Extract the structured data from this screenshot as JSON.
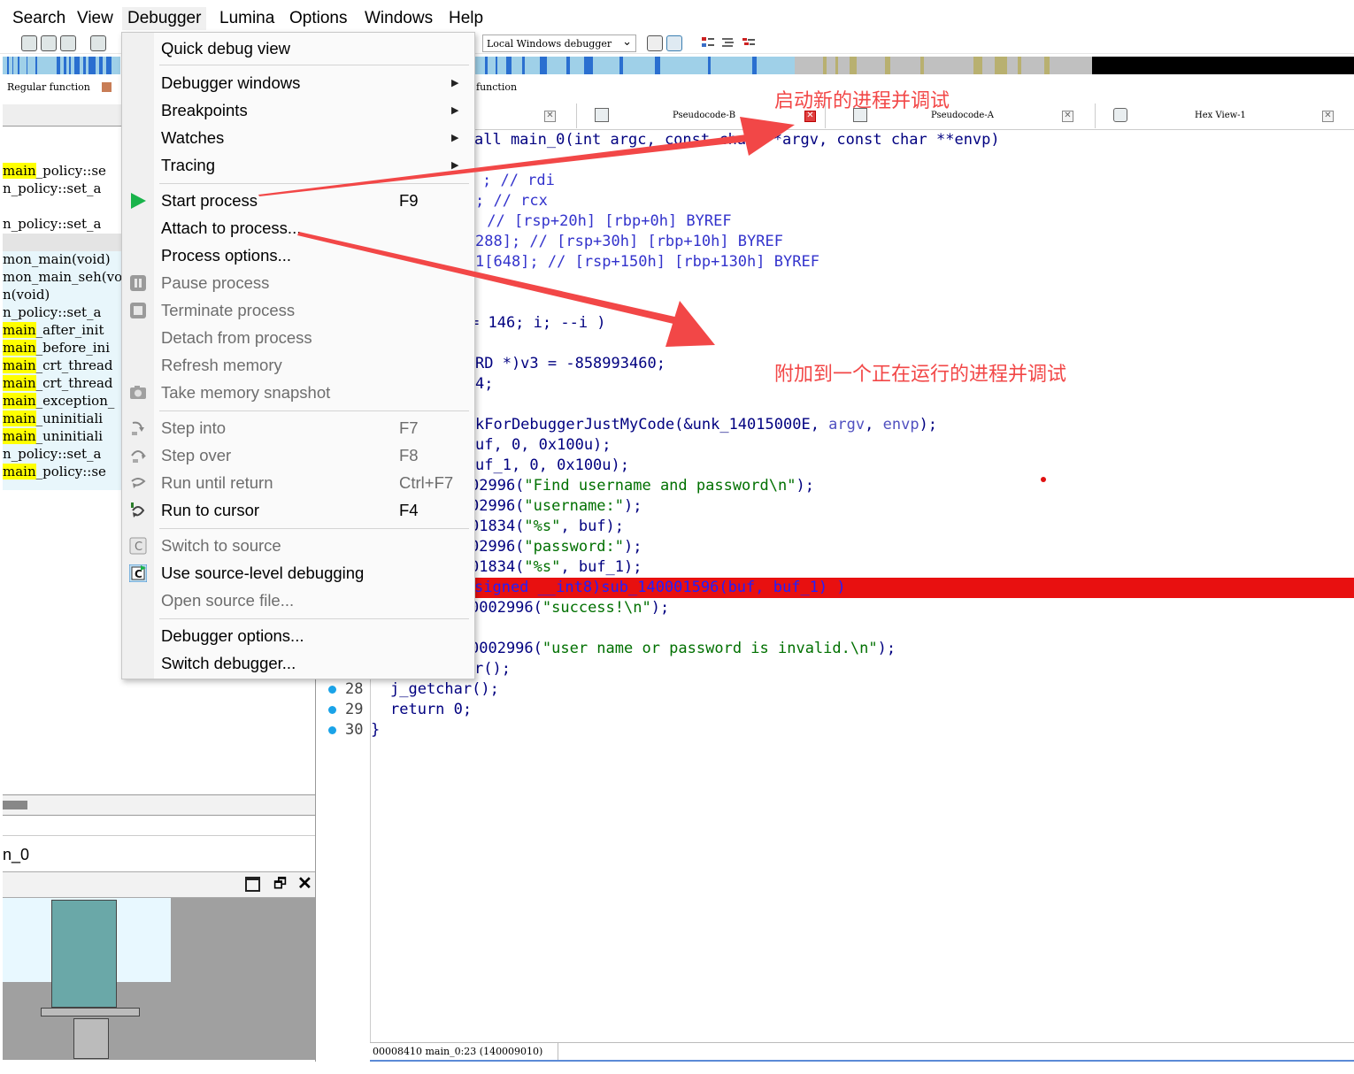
{
  "menubar": {
    "items": [
      "Search",
      "View",
      "Debugger",
      "Lumina",
      "Options",
      "Windows",
      "Help"
    ]
  },
  "toolbar": {
    "debugger_select": "Local Windows debugger"
  },
  "legend": {
    "regular_function": "Regular function",
    "function": "function"
  },
  "left_panel": {
    "lines": [
      {
        "hl": "main",
        "rest": "_policy::se"
      },
      {
        "hl": "",
        "rest": "n_policy::set_a"
      },
      {
        "hl": "",
        "rest": "n_policy::set_a"
      },
      {
        "hl": "",
        "rest": "mon_main(void)"
      },
      {
        "hl": "",
        "rest": "mon_main_seh(vo"
      },
      {
        "hl": "",
        "rest": "n(void)"
      },
      {
        "hl": "",
        "rest": "n_policy::set_a"
      },
      {
        "hl": "main",
        "rest": "_after_init"
      },
      {
        "hl": "main",
        "rest": "_before_ini"
      },
      {
        "hl": "main",
        "rest": "_crt_thread"
      },
      {
        "hl": "main",
        "rest": "_crt_thread"
      },
      {
        "hl": "main",
        "rest": "_exception_"
      },
      {
        "hl": "main",
        "rest": "_uninitiali"
      },
      {
        "hl": "main",
        "rest": "_uninitiali"
      },
      {
        "hl": "",
        "rest": "n_policy::set_a"
      },
      {
        "hl": "main",
        "rest": "_policy::se"
      }
    ],
    "function_name": "n_0"
  },
  "tabs": [
    {
      "label": "Pseudocode-B"
    },
    {
      "label": "Pseudocode-A"
    },
    {
      "label": "Hex View-1"
    }
  ],
  "code": {
    "line_numbers": [
      "28",
      "29",
      "30"
    ],
    "l_sig_a": "all main_0(int ",
    "l_sig_b": "argc, const",
    "l_sig_c": " char **argv, const char **envp)",
    "l1": "; // rdi",
    "l2": "; // rcx",
    "l3": " // [rsp+20h] [rbp+0h] BYREF",
    "l4": "288]; // [rsp+30h] [rbp+10h] BYREF",
    "l5": "1[648]; // [rsp+150h] [rbp+130h] BYREF",
    "l6": "= 146; i; --i )",
    "l7": "RD *)v3 = -858993460;",
    "l8": "4;",
    "l9a": "kForDebuggerJustMyCode(&unk_14015000E, ",
    "l9b": "argv",
    "l9c": ", ",
    "l9d": "envp",
    "l9e": ");",
    "l10": "uf, 0, 0x100u);",
    "l11": "uf_1, 0, 0x100u);",
    "l12a": "02996(",
    "l12b": "\"Find username and password\\n\"",
    "l12c": ");",
    "l13a": "02996(",
    "l13b": "\"username:\"",
    "l13c": ");",
    "l14a": "01834(",
    "l14b": "\"%s\"",
    "l14c": ", buf);",
    "l15a": "02996(",
    "l15b": "\"password:\"",
    "l15c": ");",
    "l16a": "01834(",
    "l16b": "\"%s\"",
    "l16c": ", buf_1);",
    "l17": "signed __int8)sub_140001596(buf, buf_1) )",
    "l18a": "0002996(",
    "l18b": "\"success!\\n\"",
    "l18c": ");",
    "l19a": "0002996(",
    "l19b": "\"user name or password is invalid.\\n\"",
    "l19c": ");",
    "l20": "r();",
    "l28": "j_getchar();",
    "l29": "return 0;",
    "l30": "}"
  },
  "dropdown": {
    "quick": "Quick debug view",
    "debugger_windows": "Debugger windows",
    "breakpoints": "Breakpoints",
    "watches": "Watches",
    "tracing": "Tracing",
    "start_process": "Start process",
    "start_shortcut": "F9",
    "attach": "Attach to process...",
    "process_options": "Process options...",
    "pause": "Pause process",
    "terminate": "Terminate process",
    "detach": "Detach from process",
    "refresh": "Refresh memory",
    "snapshot": "Take memory snapshot",
    "step_into": "Step into",
    "step_into_sc": "F7",
    "step_over": "Step over",
    "step_over_sc": "F8",
    "run_until": "Run until return",
    "run_until_sc": "Ctrl+F7",
    "run_cursor": "Run to cursor",
    "run_cursor_sc": "F4",
    "switch_source": "Switch to source",
    "use_source": "Use source-level debugging",
    "open_source": "Open source file...",
    "debugger_options": "Debugger options...",
    "switch_debugger": "Switch debugger..."
  },
  "annotations": {
    "start_new": "启动新的进程并调试",
    "attach_running": "附加到一个正在运行的进程并调试"
  },
  "status": {
    "text": "00008410 main_0:23 (140009010)"
  },
  "colors": {
    "annotation": "#f24747",
    "highlight_line": "#e81010",
    "keyword": "#000080",
    "string": "#007000",
    "breakpoint_dot": "#1aa3e8"
  }
}
